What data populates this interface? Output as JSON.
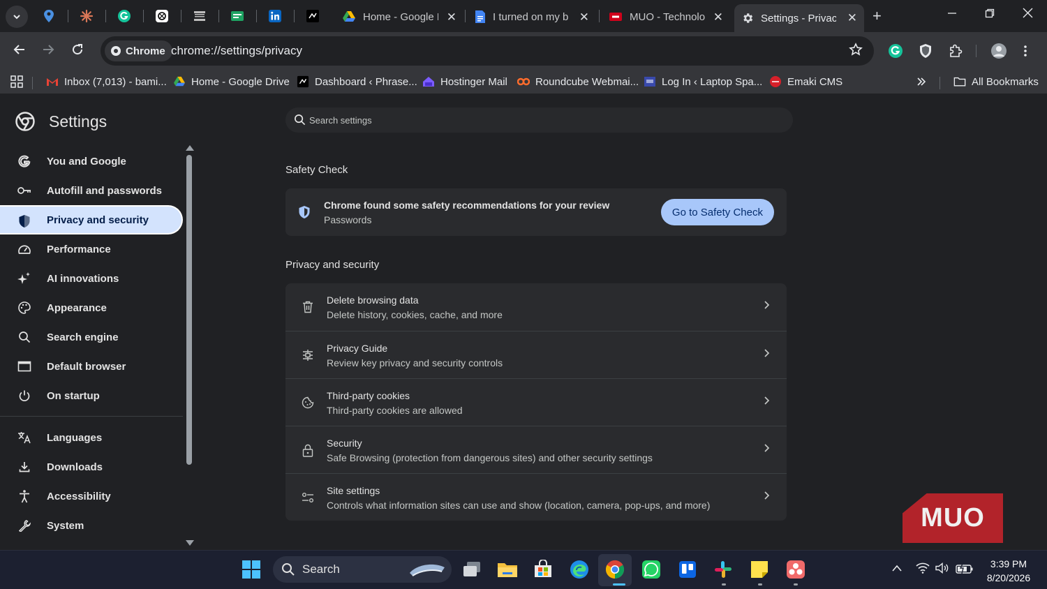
{
  "browser": {
    "tabs": [
      {
        "title": "Home - Google D",
        "active": false
      },
      {
        "title": "I turned on my b",
        "active": false
      },
      {
        "title": "MUO - Technolog",
        "active": false
      },
      {
        "title": "Settings - Privacy",
        "active": true
      }
    ],
    "chip_label": "Chrome",
    "url": "chrome://settings/privacy"
  },
  "bookmarks": [
    {
      "label": "Inbox (7,013) - bami..."
    },
    {
      "label": "Home - Google Drive"
    },
    {
      "label": "Dashboard ‹ Phrase..."
    },
    {
      "label": "Hostinger Mail"
    },
    {
      "label": "Roundcube Webmai..."
    },
    {
      "label": "Log In ‹ Laptop Spa..."
    },
    {
      "label": "Emaki CMS"
    }
  ],
  "all_bookmarks_label": "All Bookmarks",
  "settings": {
    "title": "Settings",
    "search_placeholder": "Search settings",
    "nav": [
      {
        "label": "You and Google"
      },
      {
        "label": "Autofill and passwords"
      },
      {
        "label": "Privacy and security",
        "active": true
      },
      {
        "label": "Performance"
      },
      {
        "label": "AI innovations"
      },
      {
        "label": "Appearance"
      },
      {
        "label": "Search engine"
      },
      {
        "label": "Default browser"
      },
      {
        "label": "On startup"
      }
    ],
    "nav2": [
      {
        "label": "Languages"
      },
      {
        "label": "Downloads"
      },
      {
        "label": "Accessibility"
      },
      {
        "label": "System"
      }
    ],
    "safety_check": {
      "section_title": "Safety Check",
      "title": "Chrome found some safety recommendations for your review",
      "subtitle": "Passwords",
      "button": "Go to Safety Check"
    },
    "privacy": {
      "section_title": "Privacy and security",
      "rows": [
        {
          "title": "Delete browsing data",
          "subtitle": "Delete history, cookies, cache, and more"
        },
        {
          "title": "Privacy Guide",
          "subtitle": "Review key privacy and security controls"
        },
        {
          "title": "Third-party cookies",
          "subtitle": "Third-party cookies are allowed"
        },
        {
          "title": "Security",
          "subtitle": "Safe Browsing (protection from dangerous sites) and other security settings"
        },
        {
          "title": "Site settings",
          "subtitle": "Controls what information sites can use and show (location, camera, pop-ups, and more)"
        }
      ]
    }
  },
  "watermark": "MUO",
  "taskbar": {
    "search_label": "Search",
    "time": "3:39 PM",
    "date": "8/20/2026"
  },
  "colors": {
    "accent_nav_bg": "#d3e3fd",
    "safety_button": "#a8c7fa",
    "watermark": "#b2232a"
  }
}
